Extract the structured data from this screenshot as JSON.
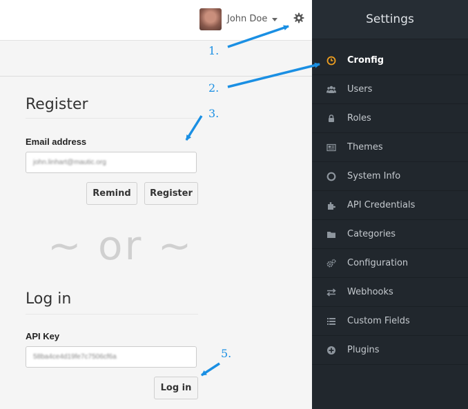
{
  "header": {
    "user_name": "John Doe"
  },
  "register": {
    "title": "Register",
    "email_label": "Email address",
    "email_value": "john.linhart@mautic.org",
    "remind_label": "Remind",
    "register_label": "Register"
  },
  "divider": {
    "text": "~ or ~"
  },
  "login": {
    "title": "Log in",
    "api_key_label": "API Key",
    "api_key_value": "58ba4ce4d19fe7c7506cf6a",
    "login_label": "Log in"
  },
  "sidebar": {
    "title": "Settings",
    "accent_color": "#f0a020",
    "items": [
      {
        "label": "Cronfig",
        "icon": "clock-icon",
        "active": true
      },
      {
        "label": "Users",
        "icon": "users-icon"
      },
      {
        "label": "Roles",
        "icon": "lock-icon"
      },
      {
        "label": "Themes",
        "icon": "newspaper-icon"
      },
      {
        "label": "System Info",
        "icon": "life-ring-icon"
      },
      {
        "label": "API Credentials",
        "icon": "puzzle-icon"
      },
      {
        "label": "Categories",
        "icon": "folder-icon"
      },
      {
        "label": "Configuration",
        "icon": "cogs-icon"
      },
      {
        "label": "Webhooks",
        "icon": "exchange-icon"
      },
      {
        "label": "Custom Fields",
        "icon": "list-icon"
      },
      {
        "label": "Plugins",
        "icon": "plus-circle-icon"
      }
    ]
  },
  "annotations": {
    "a1": "1.",
    "a2": "2.",
    "a3": "3.",
    "a5": "5.",
    "color": "#1a8fe3"
  }
}
